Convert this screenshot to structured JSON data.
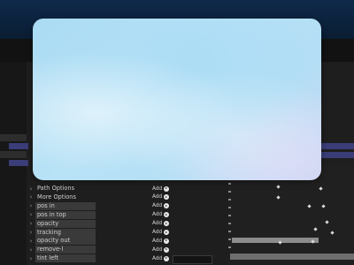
{
  "properties": [
    {
      "label": "Path Options",
      "boxed": false,
      "add": ""
    },
    {
      "label": "More Options",
      "boxed": false,
      "add": ""
    },
    {
      "label": "pos in",
      "boxed": true,
      "add": "Add"
    },
    {
      "label": "pos in top",
      "boxed": true,
      "add": "Add"
    },
    {
      "label": "opacity",
      "boxed": true,
      "add": "Add"
    },
    {
      "label": "tracking",
      "boxed": true,
      "add": "Add"
    },
    {
      "label": "opacity out",
      "boxed": true,
      "add": "Add"
    },
    {
      "label": "remove-l",
      "boxed": true,
      "add": "Add"
    },
    {
      "label": "tint left",
      "boxed": true,
      "add": "Add"
    }
  ],
  "top_add_labels": [
    "Add",
    "Add"
  ],
  "colors": {
    "header_blue": "#0f2a4a",
    "panel": "#1e1e1e",
    "overlay": "#b3def5",
    "accent_strip": "#3a3d78"
  }
}
